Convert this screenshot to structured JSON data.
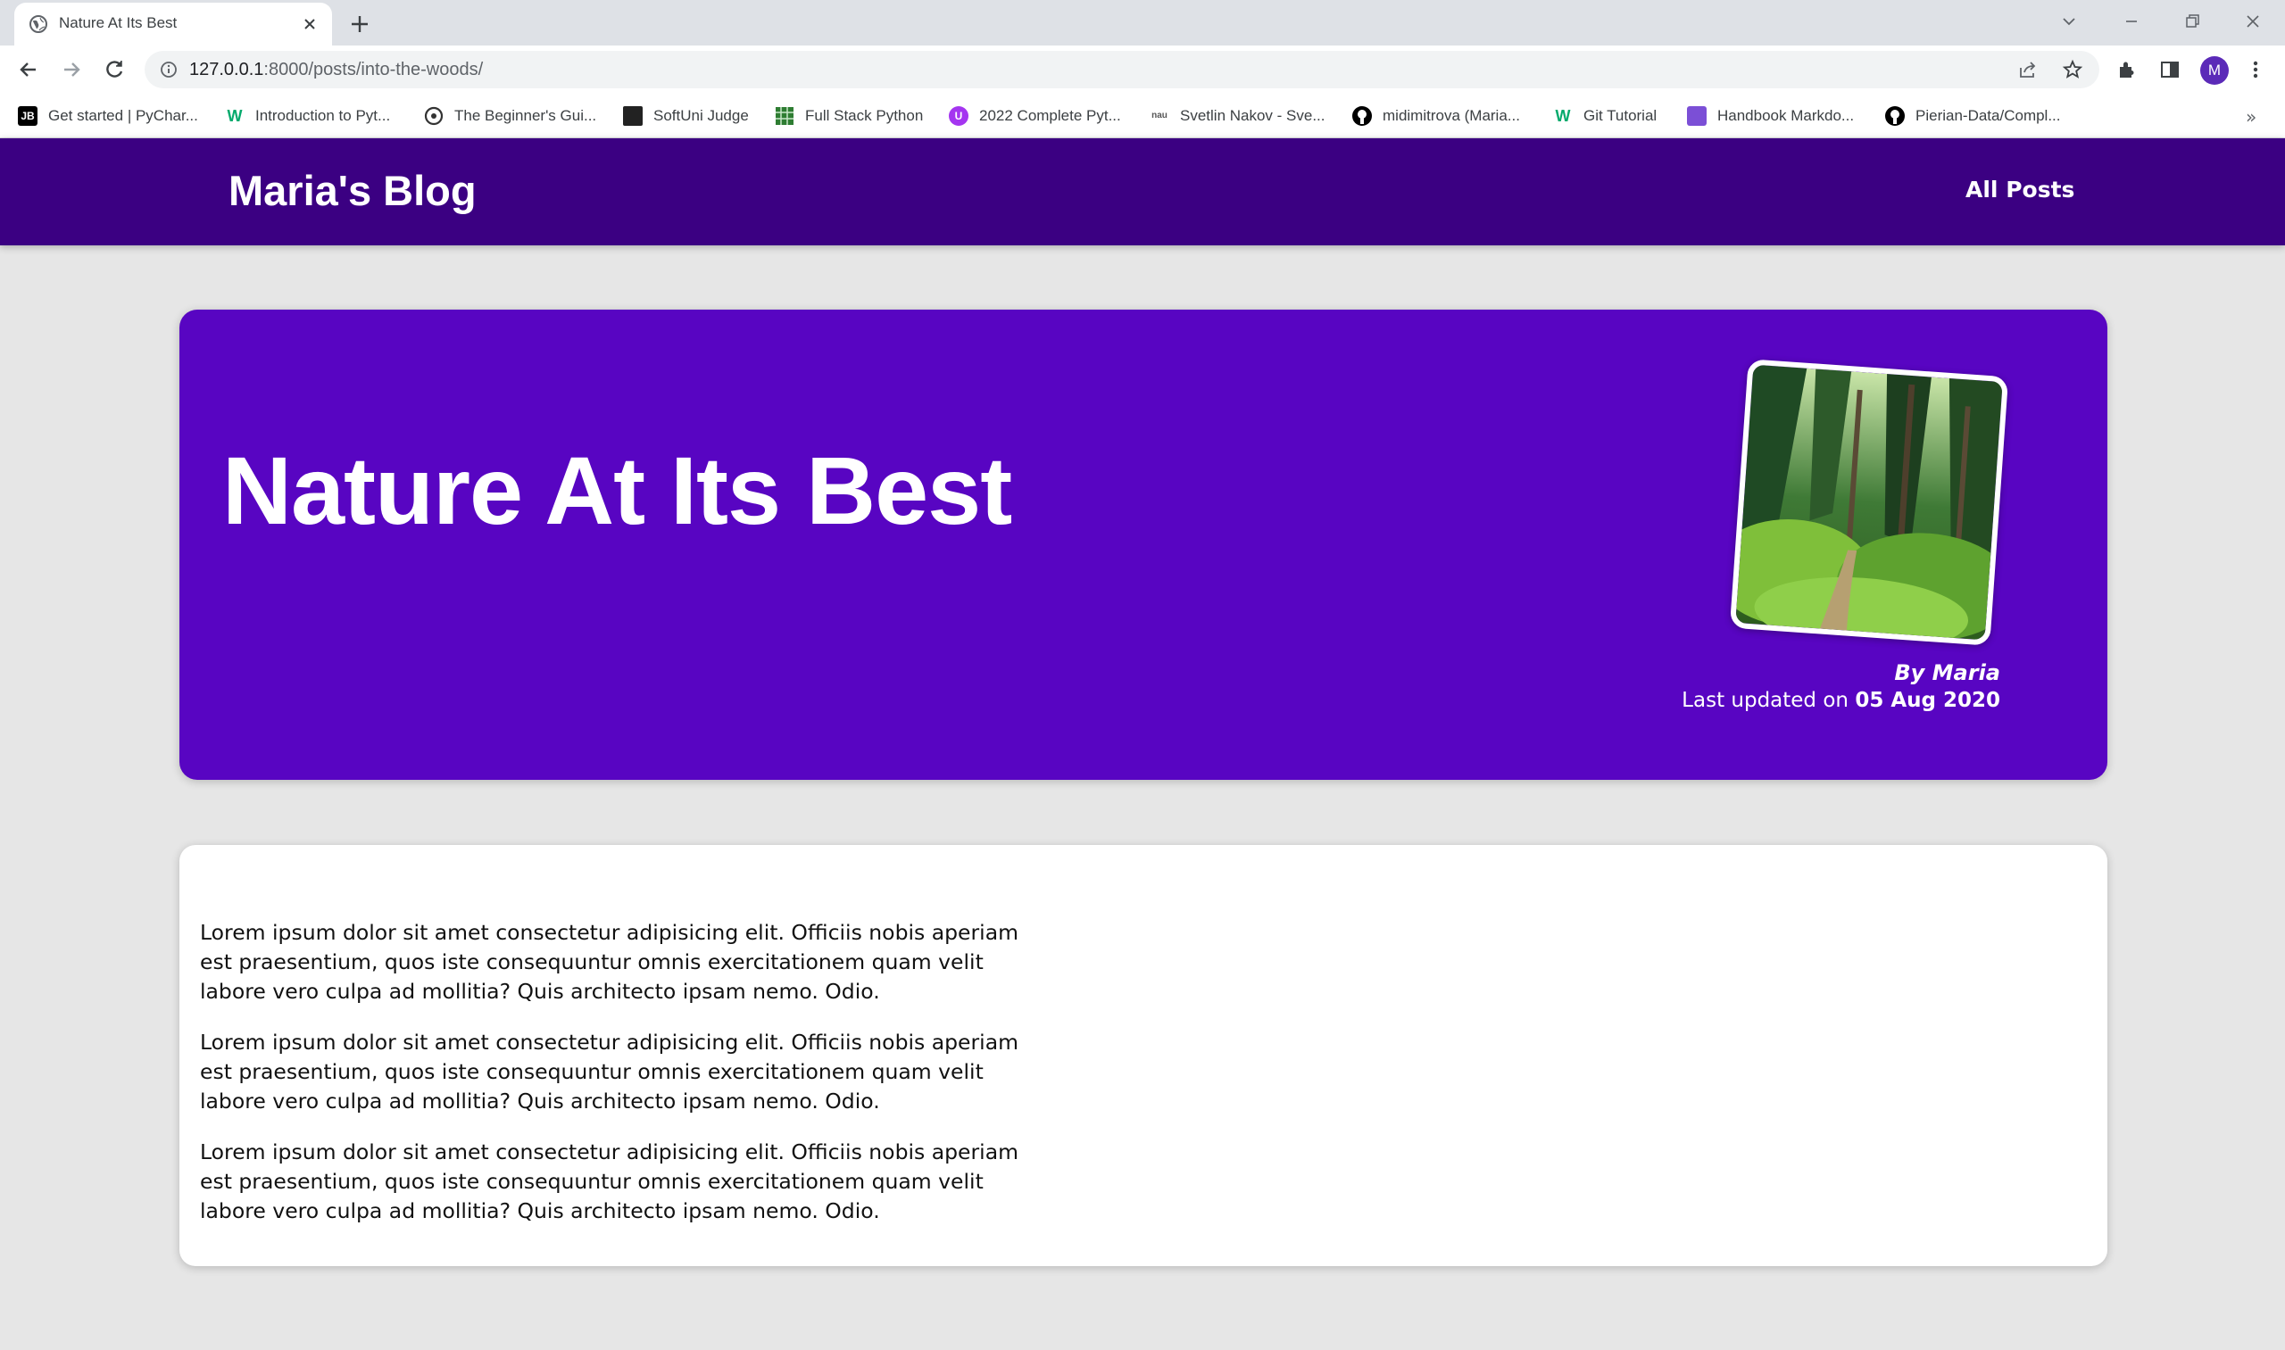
{
  "browser": {
    "tab_title": "Nature At Its Best",
    "url_host": "127.0.0.1",
    "url_rest": ":8000/posts/into-the-woods/",
    "profile_initial": "M",
    "bookmarks": [
      {
        "label": "Get started | PyChar...",
        "icon": "jetbrains-icon",
        "color": "#000000"
      },
      {
        "label": "Introduction to Pyt...",
        "icon": "w3-icon",
        "color": "#04aa6d"
      },
      {
        "label": "The Beginner's Gui...",
        "icon": "globe-icon",
        "color": "#333333"
      },
      {
        "label": "SoftUni Judge",
        "icon": "judge-icon",
        "color": "#222222"
      },
      {
        "label": "Full Stack Python",
        "icon": "grid-icon",
        "color": "#2e7d32"
      },
      {
        "label": "2022 Complete Pyt...",
        "icon": "udemy-icon",
        "color": "#a435f0"
      },
      {
        "label": "Svetlin Nakov - Sve...",
        "icon": "nakov-icon",
        "color": "#555555"
      },
      {
        "label": "midimitrova (Maria...",
        "icon": "github-icon",
        "color": "#000000"
      },
      {
        "label": "Git Tutorial",
        "icon": "w3-icon",
        "color": "#04aa6d"
      },
      {
        "label": "Handbook Markdo...",
        "icon": "handbook-icon",
        "color": "#7b4fd6"
      },
      {
        "label": "Pierian-Data/Compl...",
        "icon": "github-icon",
        "color": "#000000"
      }
    ]
  },
  "header": {
    "logo": "Maria's Blog",
    "nav_all_posts": "All Posts",
    "background": "#3b0082"
  },
  "hero": {
    "title": "Nature At Its Best",
    "image_alt": "forest path",
    "author": "By Maria",
    "updated_prefix": "Last updated on ",
    "updated_date": "05 Aug 2020",
    "background": "#5805c2"
  },
  "content": {
    "paragraphs": [
      "Lorem ipsum dolor sit amet consectetur adipisicing elit. Officiis nobis aperiam est praesentium, quos iste consequuntur omnis exercitationem quam velit labore vero culpa ad mollitia? Quis architecto ipsam nemo. Odio.",
      "Lorem ipsum dolor sit amet consectetur adipisicing elit. Officiis nobis aperiam est praesentium, quos iste consequuntur omnis exercitationem quam velit labore vero culpa ad mollitia? Quis architecto ipsam nemo. Odio.",
      "Lorem ipsum dolor sit amet consectetur adipisicing elit. Officiis nobis aperiam est praesentium, quos iste consequuntur omnis exercitationem quam velit labore vero culpa ad mollitia? Quis architecto ipsam nemo. Odio."
    ]
  }
}
